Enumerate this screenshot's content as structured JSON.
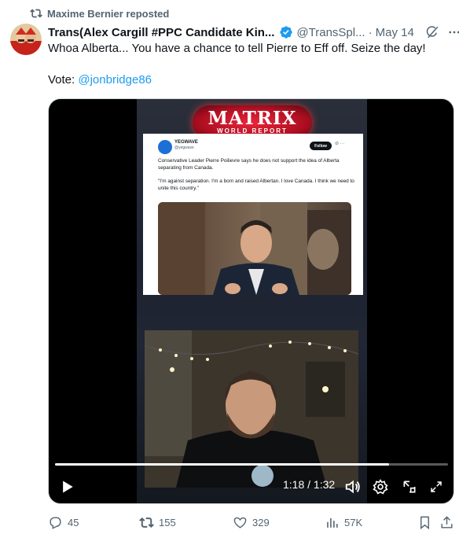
{
  "repost": {
    "label": "Maxime Bernier reposted",
    "icon": "repost-icon"
  },
  "post": {
    "author_name": "Trans(Alex Cargill #PPC Candidate Kin...",
    "handle": "@TransSpl...",
    "separator": "·",
    "date": "May 14",
    "text_line1": "Whoa Alberta... You have a chance to tell Pierre to Eff off.  Seize the day!",
    "vote_prefix": "Vote: ",
    "vote_mention": "@jonbridge86",
    "verified_color": "#1d9bf0"
  },
  "video": {
    "logo_title": "MATRIX",
    "logo_subtitle": "WORLD REPORT",
    "embedded_tweet": {
      "account_name": "YEGWAVE",
      "account_handle": "@yegwave",
      "follow_label": "Follow",
      "body_1": "Conservative Leader Pierre Poilievre says he does not support the idea of Alberta separating from Canada.",
      "body_2": "\"I'm against separation. I'm a born and raised Albertan. I love Canada. I think we need to unite this country.\""
    },
    "current_time": "1:18",
    "duration": "1:32",
    "time_separator": " / ",
    "progress": 0.85,
    "controls": [
      "play-icon",
      "volume-icon",
      "settings-icon",
      "picture-in-picture-icon",
      "fullscreen-icon"
    ]
  },
  "actions": {
    "replies": "45",
    "reposts": "155",
    "likes": "329",
    "views": "57K"
  },
  "colors": {
    "muted": "#536471",
    "accent": "#1d9bf0",
    "text": "#0f1419"
  }
}
